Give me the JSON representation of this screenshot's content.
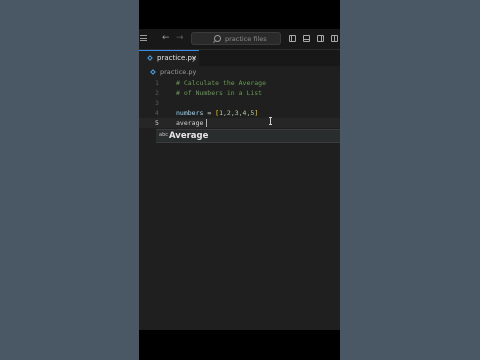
{
  "titlebar": {
    "back_arrow": "←",
    "forward_arrow": "→",
    "search_placeholder": "practice files",
    "icons": [
      "menu-icon",
      "back-arrow-icon",
      "forward-arrow-icon",
      "search-icon",
      "toggle-primary-sidebar-icon",
      "toggle-panel-icon",
      "toggle-secondary-sidebar-icon",
      "customize-layout-icon"
    ]
  },
  "tab": {
    "label": "practice.py",
    "close": "×"
  },
  "breadcrumb": {
    "file": "practice.py"
  },
  "code": {
    "lines": [
      {
        "num": "1",
        "text": "# Calculate the Average"
      },
      {
        "num": "2",
        "text": "# of Numbers in a List"
      },
      {
        "num": "3",
        "text": ""
      },
      {
        "num": "4",
        "var": "numbers",
        "op": " = ",
        "open": "[",
        "values": "1,2,3,4,5",
        "close": "]"
      },
      {
        "num": "5",
        "text": "average"
      }
    ]
  },
  "suggestion": {
    "kind": "abc",
    "word": "Average"
  },
  "colors": {
    "accent": "#3b8ee8",
    "comment": "#6a9955",
    "variable": "#9cdcfe",
    "number": "#b5cea8",
    "bracket": "#ffd700",
    "editor_bg": "#1f1f1f"
  }
}
